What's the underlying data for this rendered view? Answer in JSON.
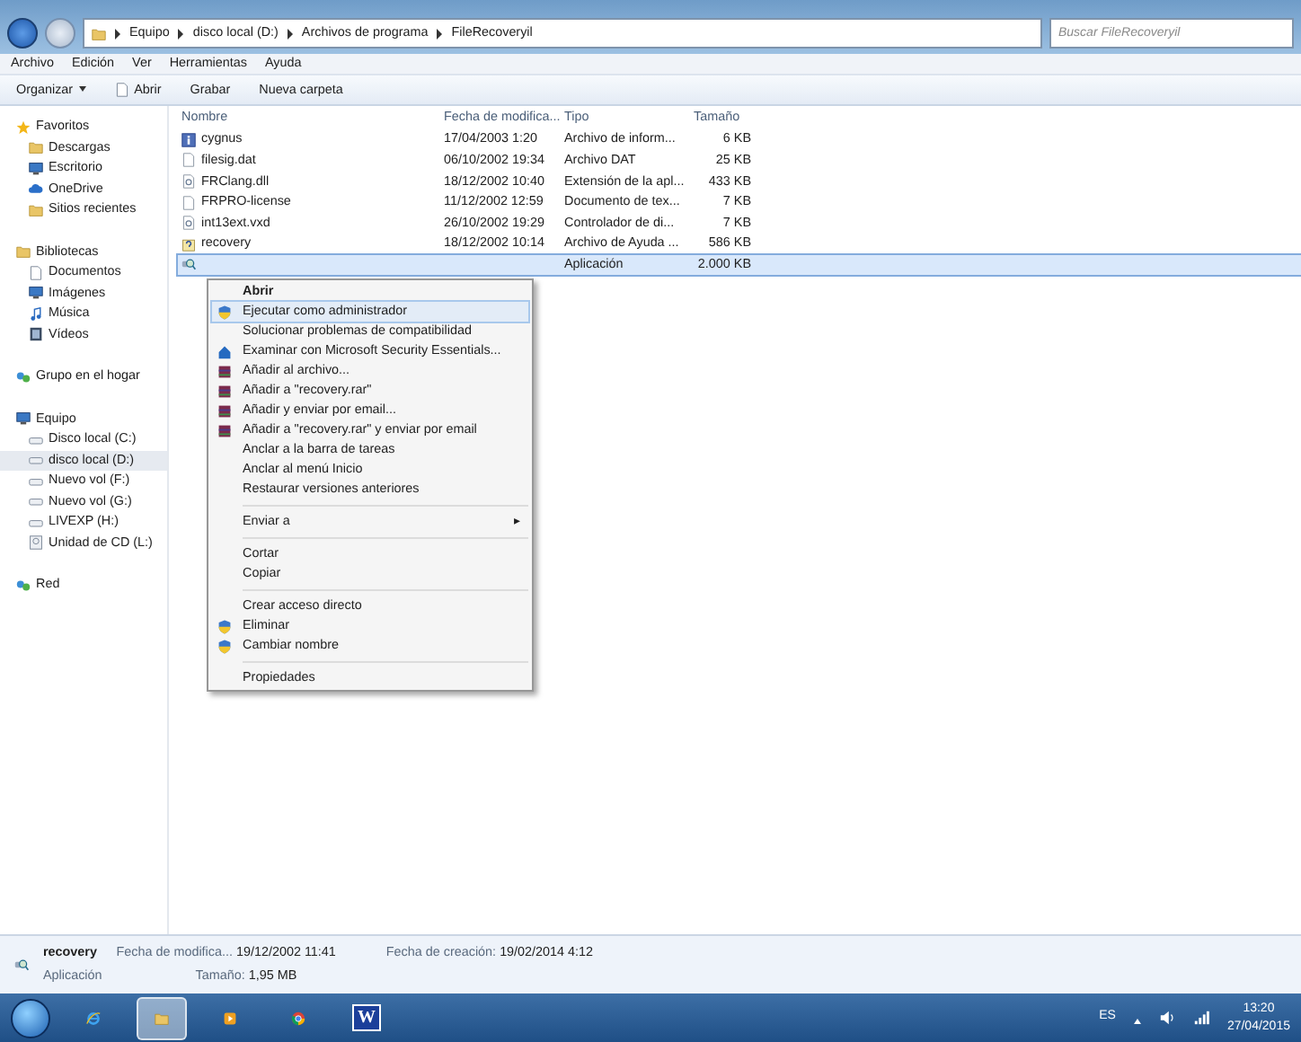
{
  "address": {
    "crumbs": [
      "Equipo",
      "disco local (D:)",
      "Archivos de programa",
      "FileRecoveryil"
    ],
    "search_placeholder": "Buscar FileRecoveryil"
  },
  "menu_bar": [
    "Archivo",
    "Edición",
    "Ver",
    "Herramientas",
    "Ayuda"
  ],
  "toolbar": [
    {
      "label": "Organizar",
      "kind": "dropdown"
    },
    {
      "label": "Abrir",
      "kind": "icon"
    },
    {
      "label": "Grabar",
      "kind": "plain"
    },
    {
      "label": "Nueva carpeta",
      "kind": "plain"
    }
  ],
  "sidebar": [
    {
      "label": "Favoritos",
      "children": [
        {
          "label": "Descargas",
          "selected": false
        },
        {
          "label": "Escritorio",
          "selected": false
        },
        {
          "label": "OneDrive",
          "selected": false
        },
        {
          "label": "Sitios recientes",
          "selected": false
        }
      ]
    },
    {
      "label": "Bibliotecas",
      "children": [
        {
          "label": "Documentos",
          "selected": false
        },
        {
          "label": "Imágenes",
          "selected": false
        },
        {
          "label": "Música",
          "selected": false
        },
        {
          "label": "Vídeos",
          "selected": false
        }
      ]
    },
    {
      "label": "Grupo en el hogar"
    },
    {
      "label": "Equipo",
      "children": [
        {
          "label": "Disco local (C:)",
          "selected": false
        },
        {
          "label": "disco local (D:)",
          "selected": true
        },
        {
          "label": "Nuevo vol (F:)",
          "selected": false
        },
        {
          "label": "Nuevo vol (G:)",
          "selected": false
        },
        {
          "label": "LIVEXP (H:)",
          "selected": false
        },
        {
          "label": "Unidad de CD (L:)",
          "selected": false
        }
      ]
    },
    {
      "label": "Red"
    }
  ],
  "table": {
    "columns": [
      "Nombre",
      "Fecha de modifica...",
      "Tipo",
      "Tamaño"
    ],
    "rows": [
      {
        "name": "cygnus",
        "date": "17/04/2003 1:20",
        "type": "Archivo de inform...",
        "size": "6 KB",
        "selected": false
      },
      {
        "name": "filesig.dat",
        "date": "06/10/2002 19:34",
        "type": "Archivo DAT",
        "size": "25 KB",
        "selected": false
      },
      {
        "name": "FRClang.dll",
        "date": "18/12/2002 10:40",
        "type": "Extensión de la apl...",
        "size": "433 KB",
        "selected": false
      },
      {
        "name": "FRPRO-license",
        "date": "11/12/2002 12:59",
        "type": "Documento de tex...",
        "size": "7 KB",
        "selected": false
      },
      {
        "name": "int13ext.vxd",
        "date": "26/10/2002 19:29",
        "type": "Controlador de di...",
        "size": "7 KB",
        "selected": false
      },
      {
        "name": "recovery",
        "date": "18/12/2002 10:14",
        "type": "Archivo de Ayuda ...",
        "size": "586 KB",
        "selected": false
      },
      {
        "type": "Aplicación",
        "size": "2.000 KB",
        "selected": true
      }
    ]
  },
  "context_menu": [
    {
      "kind": "item",
      "label": "Abrir",
      "bold": true,
      "selected": false
    },
    {
      "kind": "shield",
      "label": "Ejecutar como administrador",
      "selected": true
    },
    {
      "kind": "item",
      "label": "Solucionar problemas de compatibilidad",
      "selected": false
    },
    {
      "kind": "scan",
      "label": "Examinar con Microsoft Security Essentials...",
      "selected": false
    },
    {
      "kind": "archive",
      "label": "Añadir al archivo...",
      "selected": false
    },
    {
      "kind": "archive",
      "label": "Añadir a \"recovery.rar\"",
      "selected": false
    },
    {
      "kind": "archive",
      "label": "Añadir y enviar por email...",
      "selected": false
    },
    {
      "kind": "archive",
      "label": "Añadir a \"recovery.rar\" y enviar por email",
      "selected": false
    },
    {
      "kind": "item",
      "label": "Anclar a la barra de tareas",
      "selected": false
    },
    {
      "kind": "item",
      "label": "Anclar al menú Inicio",
      "selected": false
    },
    {
      "kind": "item",
      "label": "Restaurar versiones anteriores",
      "selected": false
    },
    {
      "kind": "separator"
    },
    {
      "kind": "submenu",
      "label": "Enviar a",
      "arrow": "▸",
      "selected": false
    },
    {
      "kind": "separator"
    },
    {
      "kind": "item",
      "label": "Cortar",
      "selected": false
    },
    {
      "kind": "item",
      "label": "Copiar",
      "selected": false
    },
    {
      "kind": "separator"
    },
    {
      "kind": "item",
      "label": "Crear acceso directo",
      "selected": false
    },
    {
      "kind": "shield",
      "label": "Eliminar",
      "selected": false
    },
    {
      "kind": "shield",
      "label": "Cambiar nombre",
      "selected": false
    },
    {
      "kind": "separator"
    },
    {
      "kind": "item",
      "label": "Propiedades",
      "selected": false
    }
  ],
  "details": {
    "name": "recovery",
    "type": "Aplicación",
    "fields": [
      {
        "label": "Fecha de modifica...",
        "value": "19/12/2002 11:41"
      },
      {
        "label": "Tamaño:",
        "value": "1,95 MB"
      },
      {
        "label": "Fecha de creación:",
        "value": "19/02/2014 4:12"
      }
    ]
  },
  "taskbar": {
    "apps": [
      {
        "selected": false
      },
      {
        "selected": true
      },
      {
        "selected": false
      },
      {
        "selected": false
      },
      {
        "label": "W",
        "selected": false
      }
    ],
    "language": "ES",
    "time": "13:20",
    "date": "27/04/2015"
  }
}
